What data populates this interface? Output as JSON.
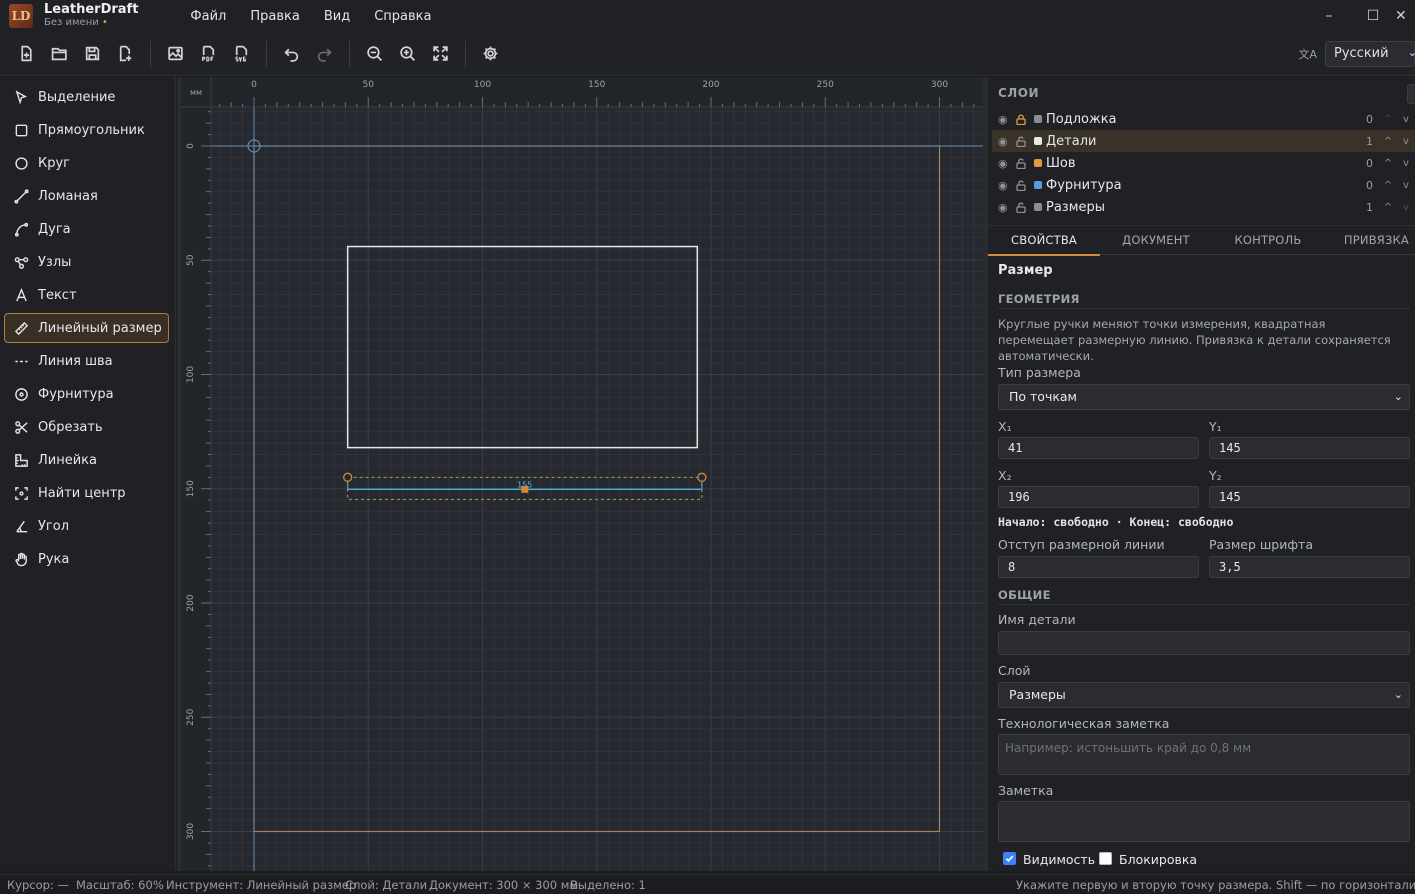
{
  "app": {
    "name": "LeatherDraft",
    "doc": "Без имени",
    "modified_mark": "•",
    "logo_glyph": "LD"
  },
  "menu": [
    "Файл",
    "Правка",
    "Вид",
    "Справка"
  ],
  "window_controls": {
    "minimize": "–",
    "maximize": "☐",
    "close": "✕"
  },
  "language": {
    "current": "Русский",
    "icon": "translate-icon"
  },
  "tools": [
    {
      "label": "Выделение",
      "icon": "cursor-icon"
    },
    {
      "label": "Прямоугольник",
      "icon": "rectangle-icon"
    },
    {
      "label": "Круг",
      "icon": "circle-icon"
    },
    {
      "label": "Ломаная",
      "icon": "polyline-icon"
    },
    {
      "label": "Дуга",
      "icon": "arc-icon"
    },
    {
      "label": "Узлы",
      "icon": "nodes-icon"
    },
    {
      "label": "Текст",
      "icon": "text-icon"
    },
    {
      "label": "Линейный размер",
      "icon": "ruler-icon",
      "active": true
    },
    {
      "label": "Линия шва",
      "icon": "dashed-line-icon"
    },
    {
      "label": "Фурнитура",
      "icon": "hardware-icon"
    },
    {
      "label": "Обрезать",
      "icon": "scissors-icon"
    },
    {
      "label": "Линейка",
      "icon": "ruler-square-icon"
    },
    {
      "label": "Найти центр",
      "icon": "center-icon"
    },
    {
      "label": "Угол",
      "icon": "angle-icon"
    },
    {
      "label": "Рука",
      "icon": "hand-icon"
    }
  ],
  "ruler": {
    "unit": "мм",
    "h_ticks": [
      "0",
      "50",
      "100",
      "150",
      "200",
      "250",
      "300"
    ],
    "v_ticks": [
      "0",
      "50",
      "100",
      "150",
      "200",
      "250",
      "300"
    ]
  },
  "canvas": {
    "dimension_label": "155"
  },
  "layers": {
    "title": "СЛОИ",
    "items": [
      {
        "name": "Подложка",
        "count": "0",
        "color": "#8a8d93",
        "locked": true
      },
      {
        "name": "Детали",
        "count": "1",
        "color": "#e8e8e8",
        "locked": false,
        "active": true
      },
      {
        "name": "Шов",
        "count": "0",
        "color": "#e29a3c",
        "locked": false
      },
      {
        "name": "Фурнитура",
        "count": "0",
        "color": "#5a9be0",
        "locked": false
      },
      {
        "name": "Размеры",
        "count": "1",
        "color": "#8a8d93",
        "locked": false
      }
    ],
    "arrow_up": "^",
    "arrow_down": "v"
  },
  "tabs": [
    "СВОЙСТВА",
    "ДОКУМЕНТ",
    "КОНТРОЛЬ",
    "ПРИВЯЗКА"
  ],
  "props": {
    "title": "Размер",
    "geometry_section": "ГЕОМЕТРИЯ",
    "hint": "Круглые ручки меняют точки измерения, квадратная перемещает размерную линию. Привязка к детали сохраняется автоматически.",
    "dim_type_label": "Тип размера",
    "dim_type_value": "По точкам",
    "x1_label": "X₁",
    "x1": "41",
    "y1_label": "Y₁",
    "y1": "145",
    "x2_label": "X₂",
    "x2": "196",
    "y2_label": "Y₂",
    "y2": "145",
    "snap_status": "Начало: свободно · Конец: свободно",
    "offset_label": "Отступ размерной линии",
    "offset": "8",
    "font_label": "Размер шрифта",
    "font": "3,5",
    "common_section": "ОБЩИЕ",
    "part_name_label": "Имя детали",
    "part_name": "",
    "layer_label": "Слой",
    "layer_value": "Размеры",
    "tech_note_label": "Технологическая заметка",
    "tech_note_placeholder": "Например: истоньшить край до 0,8 мм",
    "note_label": "Заметка",
    "visibility_label": "Видимость",
    "lock_label": "Блокировка"
  },
  "status": {
    "cursor": "Курсор: —",
    "zoom": "Масштаб: 60%",
    "tool": "Инструмент: Линейный размер",
    "layer": "Слой: Детали",
    "doc": "Документ: 300 × 300 мм",
    "selected": "Выделено: 1",
    "hint": "Укажите первую и вторую точку размера. Shift — по горизонтали/вертикали"
  },
  "colors": {
    "accent": "#d08a3a",
    "dim_line": "#4fb3d9",
    "page_border": "#c09060",
    "detail": "#e8e8e8"
  }
}
